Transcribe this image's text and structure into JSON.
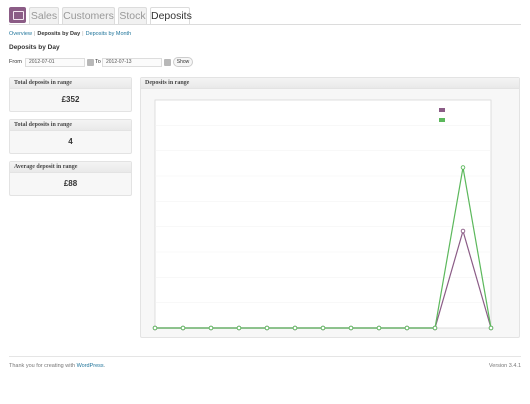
{
  "tabs": [
    {
      "label": "Sales",
      "active": false
    },
    {
      "label": "Customers",
      "active": false
    },
    {
      "label": "Stock",
      "active": false
    },
    {
      "label": "Deposits",
      "active": true
    }
  ],
  "subnav": {
    "overview": "Overview",
    "by_day": "Deposits by Day",
    "by_month": "Deposits by Month",
    "separator": "|"
  },
  "page_title": "Deposits by Day",
  "filter": {
    "from_label": "From",
    "from_value": "2012-07-01",
    "to_label": "To",
    "to_value": "2012-07-13",
    "show_button": "Show"
  },
  "stats": [
    {
      "title": "Total deposits in range",
      "value": "£352"
    },
    {
      "title": "Total deposits in range",
      "value": "4"
    },
    {
      "title": "Average deposit in range",
      "value": "£88"
    }
  ],
  "chart": {
    "title": "Deposits in range"
  },
  "chart_data": {
    "type": "line",
    "title": "Deposits in range",
    "series": [
      {
        "color": "#8b5c86",
        "values": [
          0,
          0,
          0,
          0,
          0,
          0,
          0,
          0,
          0,
          0,
          0,
          4,
          0
        ]
      },
      {
        "color": "#5cb85c",
        "values": [
          0,
          0,
          0,
          0,
          0,
          0,
          0,
          0,
          0,
          0,
          0,
          352,
          0
        ]
      }
    ],
    "x_count": 13,
    "left_ylim": [
      0,
      9.4
    ],
    "right_ylim": [
      0,
      500
    ],
    "grid": true,
    "legend_position": "top-right"
  },
  "footer": {
    "prefix": "Thank you for creating with",
    "link": "WordPress",
    "suffix": ".",
    "version": "Version 3.4.1"
  }
}
